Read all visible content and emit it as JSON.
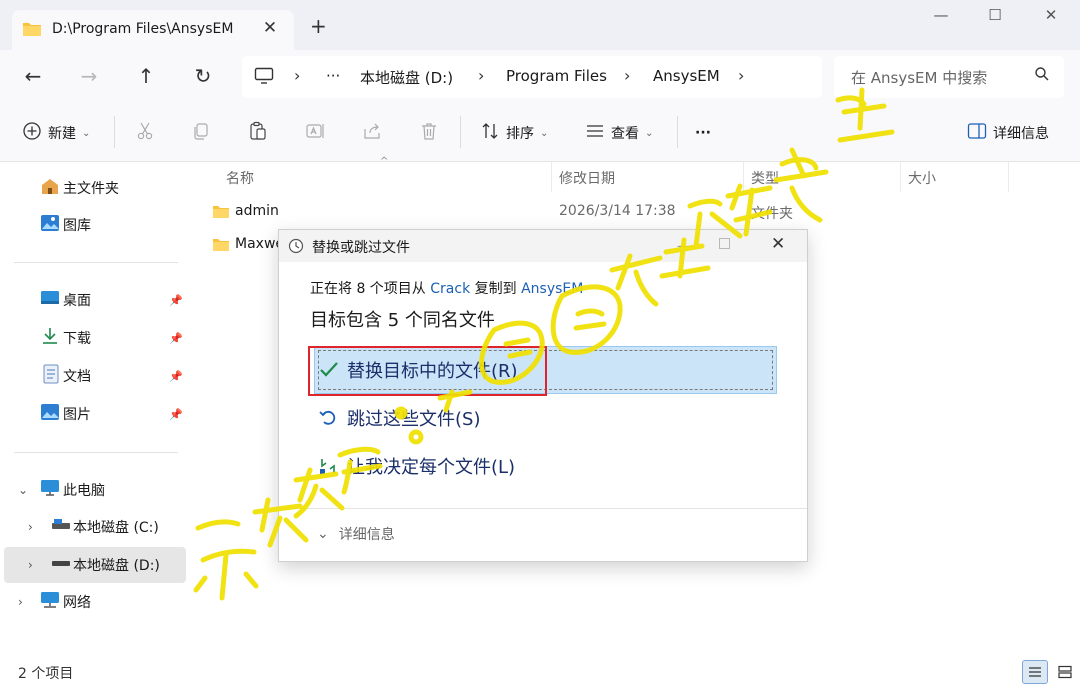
{
  "tab": {
    "title": "D:\\Program Files\\AnsysEM",
    "close": "✕"
  },
  "window": {
    "minimize": "—",
    "maximize": "☐",
    "close": "✕"
  },
  "nav": {
    "back": "←",
    "forward": "→",
    "up": "↑",
    "refresh": "↻"
  },
  "breadcrumb": {
    "more": "···",
    "items": [
      "本地磁盘 (D:)",
      "Program Files",
      "AnsysEM"
    ]
  },
  "search": {
    "placeholder": "在 AnsysEM 中搜索"
  },
  "toolbar": {
    "new_label": "新建",
    "sort_label": "排序",
    "view_label": "查看",
    "more_label": "···",
    "details_label": "详细信息"
  },
  "sidebar": {
    "items": [
      {
        "label": "主文件夹",
        "icon": "home-icon"
      },
      {
        "label": "图库",
        "icon": "gallery-icon"
      },
      {
        "label": "桌面",
        "icon": "desktop-icon",
        "pinned": true
      },
      {
        "label": "下载",
        "icon": "download-icon",
        "pinned": true
      },
      {
        "label": "文档",
        "icon": "documents-icon",
        "pinned": true
      },
      {
        "label": "图片",
        "icon": "pictures-icon",
        "pinned": true
      },
      {
        "label": "此电脑",
        "icon": "this-pc-icon",
        "expanded": true
      },
      {
        "label": "本地磁盘 (C:)",
        "icon": "drive-icon"
      },
      {
        "label": "本地磁盘 (D:)",
        "icon": "drive-icon",
        "selected": true
      },
      {
        "label": "网络",
        "icon": "network-icon"
      }
    ]
  },
  "columns": {
    "name": "名称",
    "date": "修改日期",
    "type": "类型",
    "size": "大小"
  },
  "files": [
    {
      "name": "admin",
      "date": "2026/3/14 17:38",
      "type": "文件夹"
    },
    {
      "name": "Maxwe",
      "date": "",
      "type": ""
    }
  ],
  "status": {
    "count": "2 个项目"
  },
  "dialog": {
    "title": "替换或跳过文件",
    "copy_prefix": "正在将 8 个项目从",
    "copy_source": "Crack",
    "copy_middle": "复制到",
    "copy_target": "AnsysEM",
    "heading": "目标包含 5 个同名文件",
    "option_replace": "替换目标中的文件(R)",
    "option_skip": "跳过这些文件(S)",
    "option_decide": "让我决定每个文件(L)",
    "details": "详细信息"
  },
  "colors": {
    "accent": "#1d5fb5",
    "selection": "#cce4f7",
    "highlight_red": "#e0242c",
    "watermark": "#f0e000"
  }
}
